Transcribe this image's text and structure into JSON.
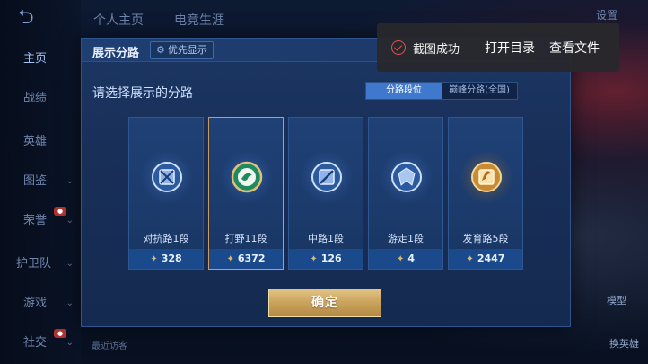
{
  "nav": {
    "back_icon": "back-arrow-icon",
    "items": [
      {
        "label": "主页"
      },
      {
        "label": "战绩"
      },
      {
        "label": "英雄"
      },
      {
        "label": "图鉴"
      },
      {
        "label": "荣誉"
      },
      {
        "label": "护卫队"
      },
      {
        "label": "游戏"
      },
      {
        "label": "社交"
      }
    ]
  },
  "top_tabs": [
    "个人主页",
    "电竞生涯"
  ],
  "settings_label": "设置",
  "side_labels": {
    "model": "模型",
    "hero": "换英雄"
  },
  "recent_visitors": "最近访客",
  "modal": {
    "title": "展示分路",
    "priority_label": "优先显示",
    "subtitle": "请选择展示的分路",
    "toggle": [
      "分路段位",
      "巅峰分路(全国)"
    ],
    "cards": [
      {
        "name": "对抗路1段",
        "score": "328",
        "color": "#a9c6ee"
      },
      {
        "name": "打野11段",
        "score": "6372",
        "color": "#2fae7d"
      },
      {
        "name": "中路1段",
        "score": "126",
        "color": "#a9c6ee"
      },
      {
        "name": "游走1段",
        "score": "4",
        "color": "#a9c6ee"
      },
      {
        "name": "发育路5段",
        "score": "2447",
        "color": "#e0a64b"
      }
    ],
    "confirm_label": "确定"
  },
  "toast": {
    "message": "截图成功",
    "open_dir": "打开目录",
    "view_file": "查看文件"
  },
  "colors": {
    "accent_gold": "#c99b62",
    "toggle_active": "#3f78cc",
    "toast_check": "#e05050"
  }
}
